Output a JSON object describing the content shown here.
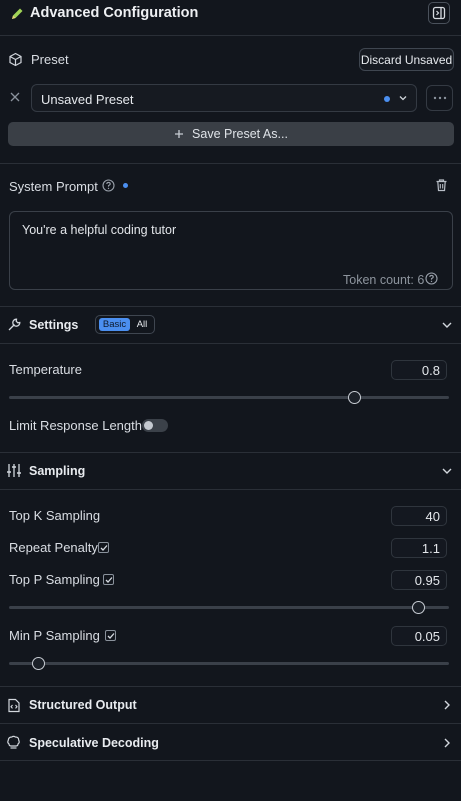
{
  "header": {
    "title": "Advanced Configuration",
    "icon": "pencil-icon",
    "toggle_icon": "sidebar-toggle-icon"
  },
  "preset": {
    "label": "Preset",
    "discard_label": "Discard Unsaved",
    "selected": "Unsaved Preset",
    "save_as_label": "Save Preset As...",
    "unsaved_dot_color": "#4b8ff0"
  },
  "system_prompt": {
    "label": "System Prompt",
    "text": "You're a helpful coding tutor",
    "token_count": "Token count: 6"
  },
  "settings": {
    "label": "Settings",
    "toggle_options": [
      "Basic",
      "All"
    ],
    "active_option": "Basic",
    "temperature": {
      "label": "Temperature",
      "value": "0.8",
      "level": 0.8
    },
    "limit_response_length": {
      "label": "Limit Response Length",
      "enabled": false
    }
  },
  "sampling": {
    "label": "Sampling",
    "top_k": {
      "label": "Top K Sampling",
      "value": "40"
    },
    "repeat_penalty": {
      "label": "Repeat Penalty",
      "value": "1.1",
      "checked": true
    },
    "top_p": {
      "label": "Top P Sampling",
      "value": "0.95",
      "checked": true,
      "level": 0.95
    },
    "min_p": {
      "label": "Min P Sampling",
      "value": "0.05",
      "checked": true,
      "level": 0.05
    }
  },
  "structured_output": {
    "label": "Structured Output"
  },
  "speculative_decoding": {
    "label": "Speculative Decoding"
  },
  "colors": {
    "background": "#12161d",
    "accent": "#4b8ff0",
    "pencil": "#9fd356"
  }
}
